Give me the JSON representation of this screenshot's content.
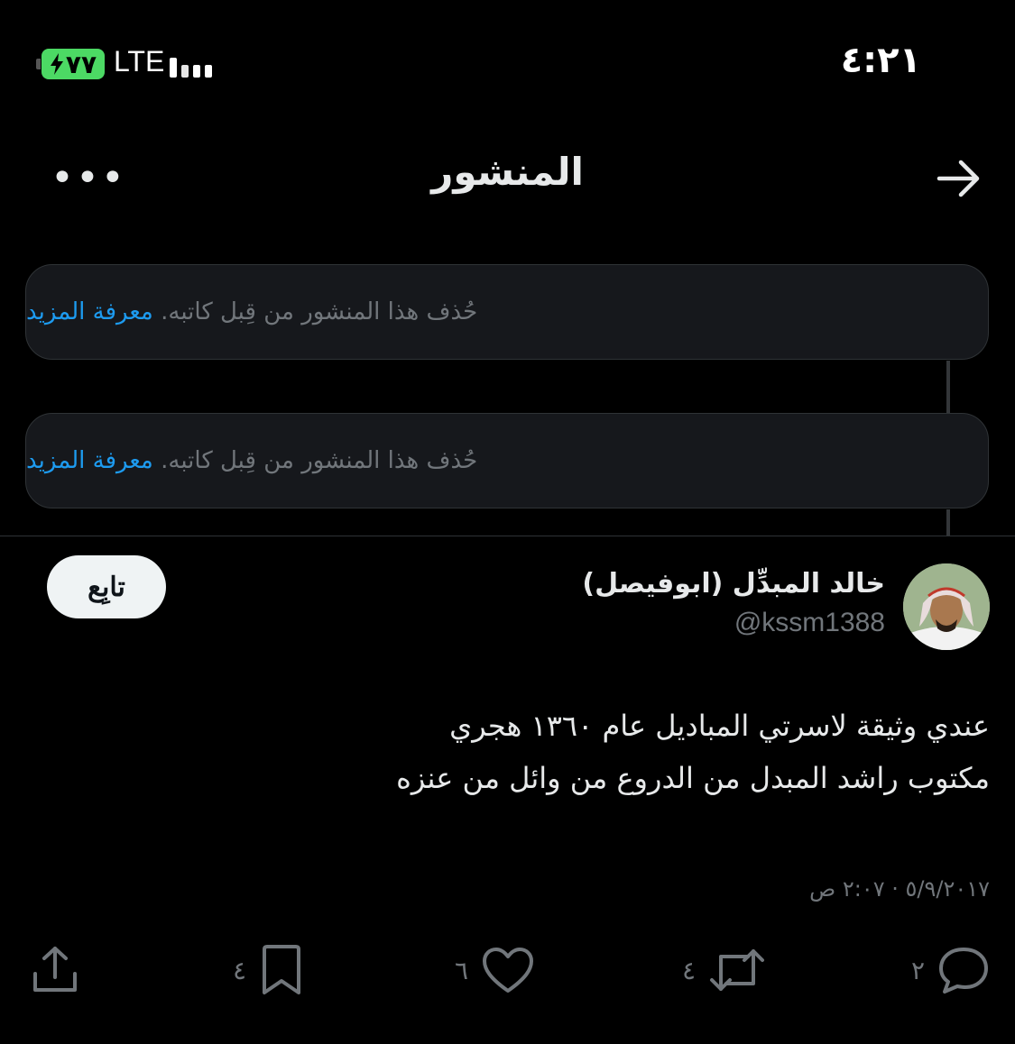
{
  "status_bar": {
    "time": "٤:٢١",
    "battery_level": "٧٧",
    "network": "LTE",
    "battery_color": "#4cd964"
  },
  "header": {
    "title": "المنشور",
    "back_icon": "arrow-right-icon",
    "more_icon": "ellipsis-icon",
    "more_label": "•••"
  },
  "deleted_posts": [
    {
      "message": "حُذف هذا المنشور من قِبل كاتبه.",
      "learn_more": "معرفة المزيد"
    },
    {
      "message": "حُذف هذا المنشور من قِبل كاتبه.",
      "learn_more": "معرفة المزيد"
    }
  ],
  "post": {
    "author_name": "خالد المبدِّل (ابوفيصل)",
    "handle": "@kssm1388",
    "follow_label": "تابِع",
    "text_line1": "عندي وثيقة لاسرتي المباديل عام ١٣٦٠ هجري",
    "text_line2": "مكتوب راشد المبدل من الدروع من وائل من عنزه",
    "timestamp": "٥/٩/٢٠١٧ · ٢:٠٧ ص"
  },
  "actions": {
    "reply_count": "٢",
    "repost_count": "٤",
    "like_count": "٦",
    "bookmark_count": "٤"
  },
  "colors": {
    "background": "#000000",
    "link": "#1d9bf0",
    "secondary_text": "#71767b",
    "card_bg": "#16181c"
  }
}
